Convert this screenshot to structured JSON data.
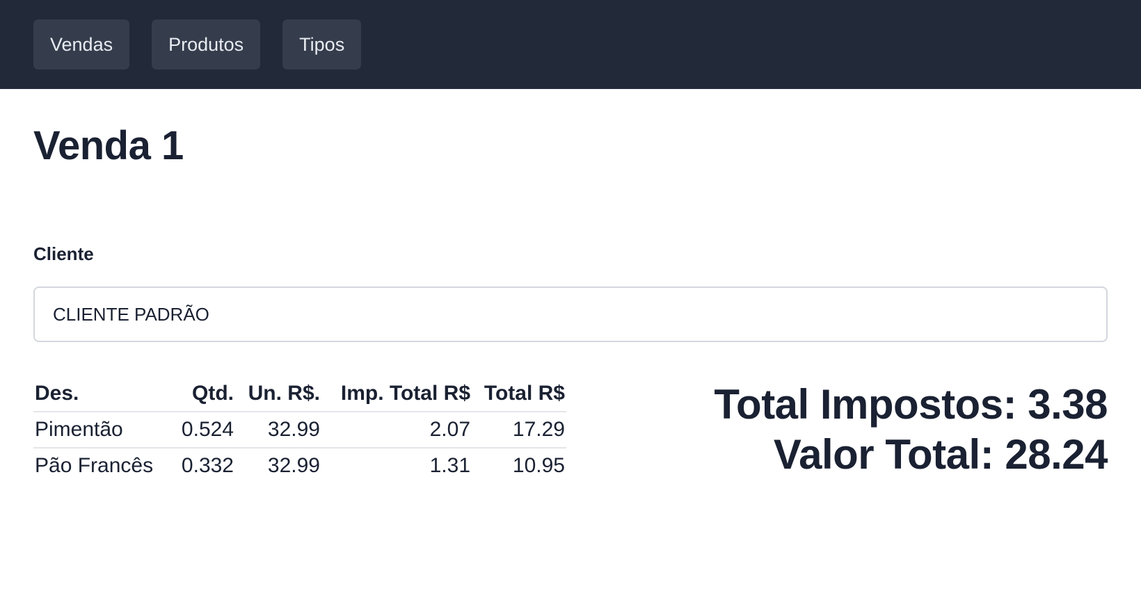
{
  "nav": {
    "items": [
      {
        "label": "Vendas"
      },
      {
        "label": "Produtos"
      },
      {
        "label": "Tipos"
      }
    ]
  },
  "page": {
    "title": "Venda 1"
  },
  "client": {
    "label": "Cliente",
    "value": "CLIENTE PADRÃO"
  },
  "items_table": {
    "headers": [
      "Des.",
      "Qtd.",
      "Un. R$.",
      "Imp. Total R$",
      "Total R$"
    ],
    "rows": [
      [
        "Pimentão",
        "0.524",
        "32.99",
        "2.07",
        "17.29"
      ],
      [
        "Pão Francês",
        "0.332",
        "32.99",
        "1.31",
        "10.95"
      ]
    ]
  },
  "totals": {
    "taxes_text": "Total Impostos: 3.38",
    "value_text": "Valor Total: 28.24"
  },
  "colors": {
    "topbar": "#222a3a",
    "nav_button": "#353d4d",
    "text": "#1a2132"
  }
}
